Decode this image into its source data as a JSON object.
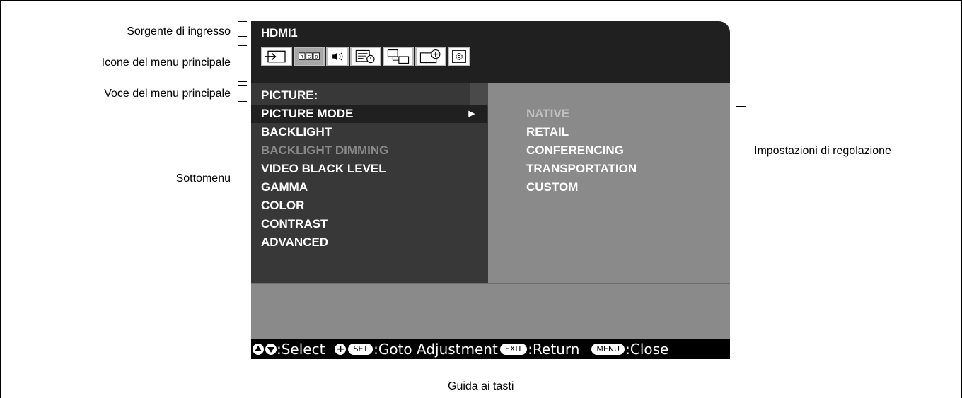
{
  "callouts": {
    "input_source": "Sorgente di ingresso",
    "main_menu_icons": "Icone del menu principale",
    "main_menu_item": "Voce del menu principale",
    "submenu": "Sottomenu",
    "adjustment_settings": "Impostazioni di regolazione",
    "key_guide": "Guida ai tasti"
  },
  "osd": {
    "input_source": "HDMI1",
    "menu_icons": [
      {
        "name": "input-icon",
        "selected": false
      },
      {
        "name": "picture-rgb-icon",
        "selected": true
      },
      {
        "name": "audio-icon",
        "selected": false
      },
      {
        "name": "schedule-icon",
        "selected": false
      },
      {
        "name": "multi-input-icon",
        "selected": false
      },
      {
        "name": "protect-icon",
        "selected": false
      },
      {
        "name": "system-icon",
        "selected": false
      }
    ],
    "main_item": "PICTURE:",
    "submenu": [
      {
        "label": "PICTURE MODE",
        "state": "selected"
      },
      {
        "label": "BACKLIGHT",
        "state": "normal"
      },
      {
        "label": "BACKLIGHT DIMMING",
        "state": "disabled"
      },
      {
        "label": "VIDEO BLACK LEVEL",
        "state": "normal"
      },
      {
        "label": "GAMMA",
        "state": "normal"
      },
      {
        "label": "COLOR",
        "state": "normal"
      },
      {
        "label": "CONTRAST",
        "state": "normal"
      },
      {
        "label": "ADVANCED",
        "state": "normal"
      }
    ],
    "adjustments": [
      {
        "label": "NATIVE",
        "state": "disabled"
      },
      {
        "label": "RETAIL",
        "state": "normal"
      },
      {
        "label": "CONFERENCING",
        "state": "normal"
      },
      {
        "label": "TRANSPORTATION",
        "state": "normal"
      },
      {
        "label": "CUSTOM",
        "state": "normal"
      }
    ],
    "key_guide": {
      "select": ":Select",
      "set_key": "SET",
      "goto": ":Goto Adjustment",
      "exit_key": "EXIT",
      "return": ":Return",
      "menu_key": "MENU",
      "close": ":Close"
    }
  },
  "colors": {
    "osd_background": "#202020",
    "submenu_background": "#383838",
    "adjustment_background": "#8a8a8a",
    "disabled_text": "#888888"
  }
}
